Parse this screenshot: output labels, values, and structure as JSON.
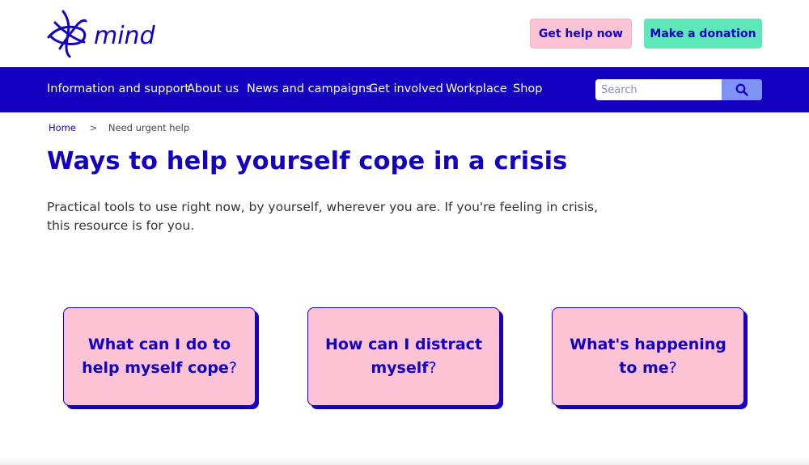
{
  "header": {
    "logo_text": "mind",
    "get_help_label": "Get help now",
    "donate_label": "Make a donation"
  },
  "nav": {
    "items": [
      {
        "label": "Information and support"
      },
      {
        "label": "About us"
      },
      {
        "label": "News and campaigns"
      },
      {
        "label": "Get involved"
      },
      {
        "label": "Workplace"
      },
      {
        "label": "Shop"
      }
    ],
    "search_placeholder": "Search",
    "search_icon": "search-icon"
  },
  "breadcrumb": {
    "home": "Home",
    "separator": ">",
    "current": "Need urgent help"
  },
  "page": {
    "title": "Ways to help yourself cope in a crisis",
    "intro": "Practical tools to use right now, by yourself, wherever you are. If you're feeling in crisis, this resource is for you."
  },
  "cards": [
    {
      "text": "What can I do to help myself cope",
      "suffix": "?"
    },
    {
      "text": "How can I distract myself",
      "suffix": "?"
    },
    {
      "text": "What's happening to me",
      "suffix": "?"
    }
  ],
  "colors": {
    "brand_blue": "#1300c1",
    "pink": "#fbc3d3",
    "green": "#5ee8ba",
    "search_button": "#7f93f5"
  }
}
